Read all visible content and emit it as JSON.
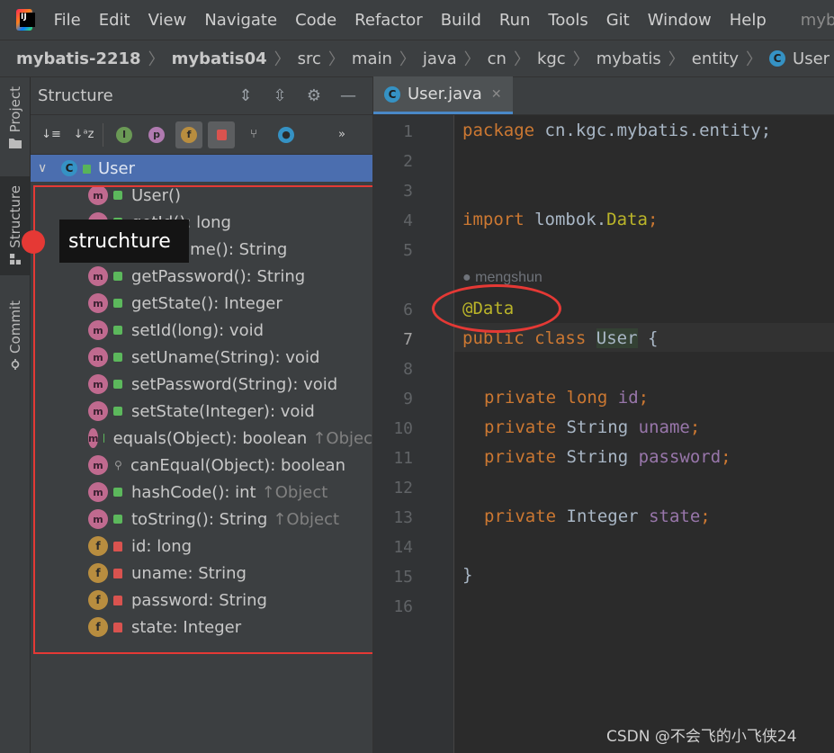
{
  "menubar": {
    "items": [
      "File",
      "Edit",
      "View",
      "Navigate",
      "Code",
      "Refactor",
      "Build",
      "Run",
      "Tools",
      "Git",
      "Window",
      "Help"
    ],
    "project": "myba"
  },
  "breadcrumb": {
    "items": [
      "mybatis-2218",
      "mybatis04",
      "src",
      "main",
      "java",
      "cn",
      "kgc",
      "mybatis",
      "entity"
    ],
    "class_label": "User"
  },
  "toolstrip": {
    "project_label": "Project",
    "structure_label": "Structure",
    "commit_label": "Commit"
  },
  "structure": {
    "title": "Structure",
    "root": "User",
    "members": [
      {
        "kind": "method",
        "vis": "public",
        "label": "User()",
        "suffix": ""
      },
      {
        "kind": "method",
        "vis": "public",
        "label": "getId(): long",
        "suffix": ""
      },
      {
        "kind": "method",
        "vis": "public",
        "label": "getUname(): String",
        "suffix": ""
      },
      {
        "kind": "method",
        "vis": "public",
        "label": "getPassword(): String",
        "suffix": ""
      },
      {
        "kind": "method",
        "vis": "public",
        "label": "getState(): Integer",
        "suffix": ""
      },
      {
        "kind": "method",
        "vis": "public",
        "label": "setId(long): void",
        "suffix": ""
      },
      {
        "kind": "method",
        "vis": "public",
        "label": "setUname(String): void",
        "suffix": ""
      },
      {
        "kind": "method",
        "vis": "public",
        "label": "setPassword(String): void",
        "suffix": ""
      },
      {
        "kind": "method",
        "vis": "public",
        "label": "setState(Integer): void",
        "suffix": ""
      },
      {
        "kind": "method",
        "vis": "public",
        "label": "equals(Object): boolean",
        "suffix": "↑Objec"
      },
      {
        "kind": "method",
        "vis": "protected",
        "label": "canEqual(Object): boolean",
        "suffix": ""
      },
      {
        "kind": "method",
        "vis": "public",
        "label": "hashCode(): int",
        "suffix": "↑Object"
      },
      {
        "kind": "method",
        "vis": "public",
        "label": "toString(): String",
        "suffix": "↑Object"
      },
      {
        "kind": "field",
        "vis": "private",
        "label": "id: long",
        "suffix": ""
      },
      {
        "kind": "field",
        "vis": "private",
        "label": "uname: String",
        "suffix": ""
      },
      {
        "kind": "field",
        "vis": "private",
        "label": "password: String",
        "suffix": ""
      },
      {
        "kind": "field",
        "vis": "private",
        "label": "state: Integer",
        "suffix": ""
      }
    ]
  },
  "tooltip": {
    "text": "struchture"
  },
  "editor": {
    "tab_label": "User.java",
    "line_numbers": [
      "1",
      "2",
      "3",
      "4",
      "5",
      "6",
      "7",
      "8",
      "9",
      "10",
      "11",
      "12",
      "13",
      "14",
      "15",
      "16"
    ],
    "current_line": "7",
    "author": "mengshun",
    "code": {
      "package_kw": "package",
      "package_name": "cn.kgc.mybatis.entity;",
      "import_kw": "import",
      "import_pkg": "lombok.",
      "import_cls": "Data",
      "import_end": ";",
      "annotation": "@Data",
      "public_kw": "public",
      "class_kw": "class",
      "class_name": "User",
      "brace_open": "{",
      "private_kw": "private",
      "long_kw": "long",
      "string_type": "String",
      "integer_type": "Integer",
      "f_id": "id",
      "f_uname": "uname",
      "f_password": "password",
      "f_state": "state",
      "semi": ";",
      "brace_close": "}"
    }
  },
  "watermark": "CSDN @不会飞的小飞侠24"
}
